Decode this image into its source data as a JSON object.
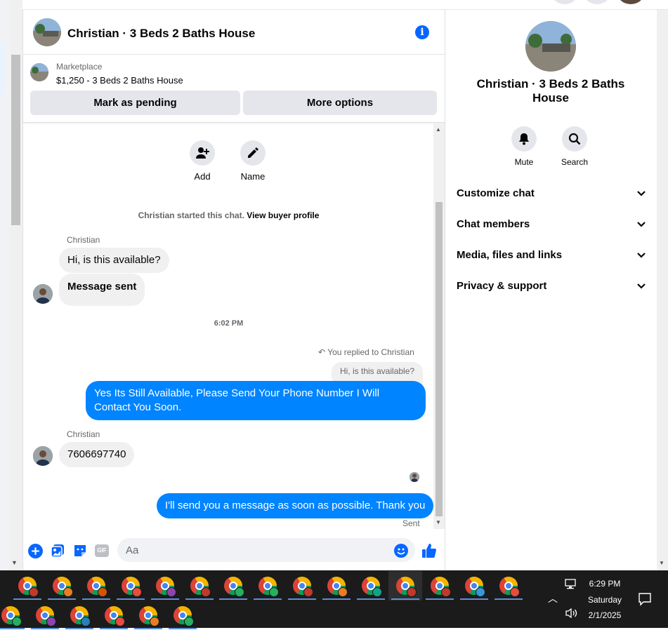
{
  "chat": {
    "title": "Christian · 3 Beds 2 Baths House",
    "listing": {
      "kicker": "Marketplace",
      "line": "$1,250 - 3 Beds 2 Baths House",
      "mark_pending_label": "Mark as pending",
      "more_options_label": "More options"
    },
    "actions": [
      {
        "label": "Add",
        "icon": "add-person-icon"
      },
      {
        "label": "Name",
        "icon": "pencil-icon"
      }
    ],
    "system_line": {
      "text": "Christian started this chat.",
      "link": "View buyer profile"
    },
    "messages": {
      "sender_1": "Christian",
      "in_1": "Hi, is this available?",
      "in_2": "Message sent",
      "timestamp": "6:02 PM",
      "reply_context": "You replied to Christian",
      "quoted": "Hi, is this available?",
      "out_1": "Yes Its Still Available, Please Send Your Phone Number I Will Contact You Soon.",
      "sender_2": "Christian",
      "in_3": "7606697740",
      "out_2": "I'll send you a message as soon as possible. Thank you",
      "status": "Sent"
    },
    "composer": {
      "placeholder": "Aa",
      "icons": [
        "plus-circle-icon",
        "photo-icon",
        "sticker-icon",
        "gif-icon",
        "emoji-icon",
        "like-icon"
      ],
      "gif_label": "GIF"
    }
  },
  "info_panel": {
    "name": "Christian · 3 Beds 2 Baths House",
    "actions": [
      {
        "label": "Mute",
        "icon": "bell-icon"
      },
      {
        "label": "Search",
        "icon": "search-icon"
      }
    ],
    "sections": [
      "Customize chat",
      "Chat members",
      "Media, files and links",
      "Privacy & support"
    ]
  },
  "taskbar": {
    "time": "6:29 PM",
    "day": "Saturday",
    "date": "2/1/2025",
    "badge_colors": [
      "#c0392b",
      "#e67e22",
      "#d35400",
      "#e74c3c",
      "#8e44ad",
      "#c0392b",
      "#27ae60",
      "#27ae60",
      "#c0392b",
      "#e67e22",
      "#16a085",
      "#c0392b",
      "#c0392b",
      "#3498db",
      "#e74c3c",
      "#27ae60",
      "#8e44ad",
      "#2980b9",
      "#e74c3c",
      "#e67e22",
      "#27ae60"
    ]
  },
  "colors": {
    "accent": "#0866ff",
    "outgoing_bubble": "#0084ff",
    "incoming_bubble": "#f0f0f0",
    "button_bg": "#e4e6eb"
  }
}
